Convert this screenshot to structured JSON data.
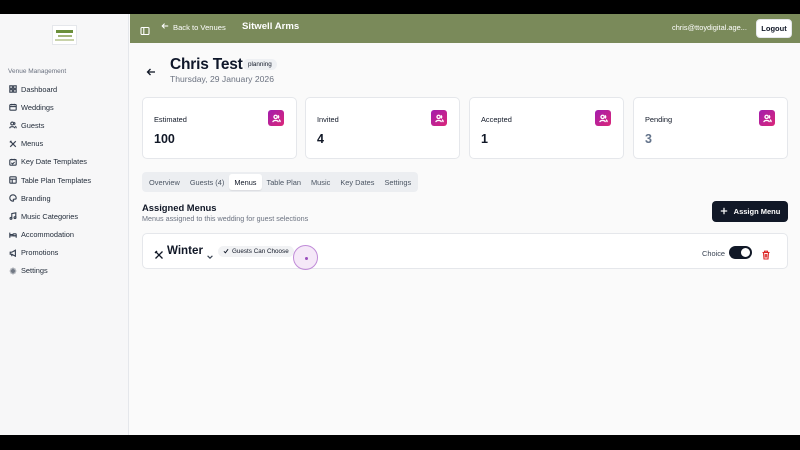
{
  "sidebar": {
    "section_label": "Venue Management",
    "items": [
      {
        "label": "Dashboard",
        "icon": "grid-icon"
      },
      {
        "label": "Weddings",
        "icon": "calendar-icon"
      },
      {
        "label": "Guests",
        "icon": "users-icon"
      },
      {
        "label": "Menus",
        "icon": "utensils-icon"
      },
      {
        "label": "Key Date Templates",
        "icon": "calendar-check-icon"
      },
      {
        "label": "Table Plan Templates",
        "icon": "layout-icon"
      },
      {
        "label": "Branding",
        "icon": "palette-icon"
      },
      {
        "label": "Music Categories",
        "icon": "music-icon"
      },
      {
        "label": "Accommodation",
        "icon": "bed-icon"
      },
      {
        "label": "Promotions",
        "icon": "megaphone-icon"
      },
      {
        "label": "Settings",
        "icon": "gear-icon"
      }
    ]
  },
  "topbar": {
    "back_label": "Back to Venues",
    "venue_name": "Sitwell Arms",
    "user_email": "chris@ttoydigital.age...",
    "logout_label": "Logout",
    "bg_color": "#7a8a5a"
  },
  "header": {
    "title": "Chris Test",
    "status": "planning",
    "date": "Thursday, 29 January 2026"
  },
  "stats": [
    {
      "label": "Estimated",
      "value": "100"
    },
    {
      "label": "Invited",
      "value": "4"
    },
    {
      "label": "Accepted",
      "value": "1"
    },
    {
      "label": "Pending",
      "value": "3"
    }
  ],
  "tabs": [
    "Overview",
    "Guests (4)",
    "Menus",
    "Table Plan",
    "Music",
    "Key Dates",
    "Settings"
  ],
  "active_tab": "Menus",
  "menus_section": {
    "title": "Assigned Menus",
    "description": "Menus assigned to this wedding for guest selections",
    "assign_label": "Assign Menu",
    "menu": {
      "name": "Winter",
      "badge": "Guests Can Choose",
      "choice_label": "Choice",
      "choice_enabled": true
    }
  },
  "colors": {
    "accent_gradient_start": "#a21caf",
    "accent_gradient_end": "#db2777",
    "primary_dark": "#111827",
    "danger": "#dc2626"
  }
}
